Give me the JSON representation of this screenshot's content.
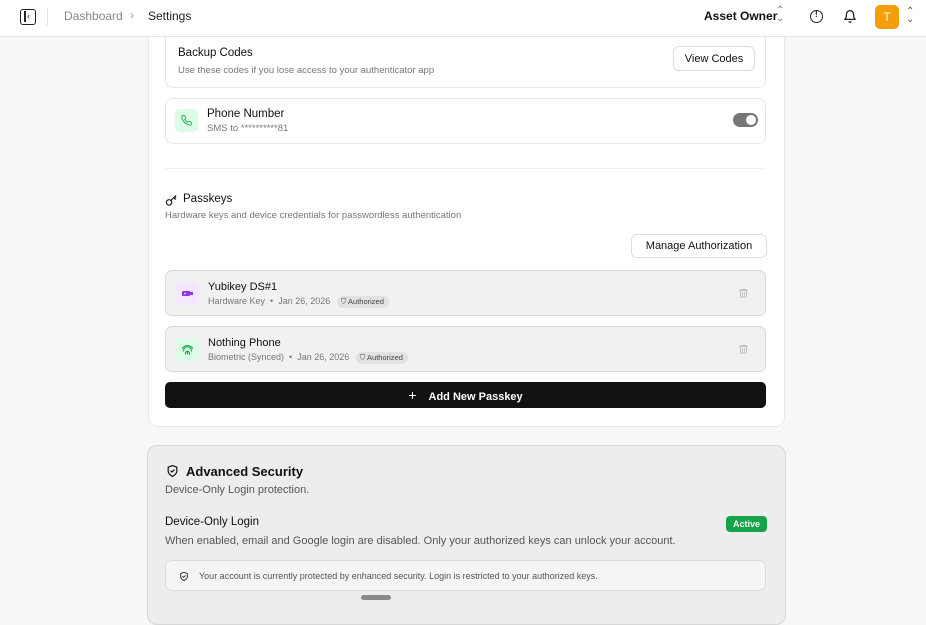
{
  "header": {
    "breadcrumb_root": "Dashboard",
    "breadcrumb_current": "Settings",
    "role": "Asset Owner",
    "avatar_initial": "T"
  },
  "backup_codes": {
    "title": "Backup Codes",
    "subtitle": "Use these codes if you lose access to your authenticator app",
    "button": "View Codes"
  },
  "phone": {
    "title": "Phone Number",
    "subtitle": "SMS to **********81",
    "enabled": true
  },
  "passkeys": {
    "title": "Passkeys",
    "subtitle": "Hardware keys and device credentials for passwordless authentication",
    "manage_button": "Manage Authorization",
    "items": [
      {
        "name": "Yubikey DS#1",
        "type": "Hardware Key",
        "date": "Jan 26, 2026",
        "badge": "Authorized",
        "icon": "usb-key-icon"
      },
      {
        "name": "Nothing Phone",
        "type": "Biometric (Synced)",
        "date": "Jan 26, 2026",
        "badge": "Authorized",
        "icon": "fingerprint-icon"
      }
    ],
    "add_button": "Add New Passkey"
  },
  "advanced": {
    "title": "Advanced Security",
    "subtitle": "Device-Only Login protection.",
    "device_only_title": "Device-Only Login",
    "device_only_status": "Active",
    "device_only_desc": "When enabled, email and Google login are disabled. Only your authorized keys can unlock your account.",
    "notice": "Your account is currently protected by enhanced security. Login is restricted to your authorized keys."
  },
  "colors": {
    "accent_orange": "#f59e0b",
    "active_green": "#16a34a",
    "usb_purple": "#9333ea",
    "phone_green": "#16a34a"
  }
}
